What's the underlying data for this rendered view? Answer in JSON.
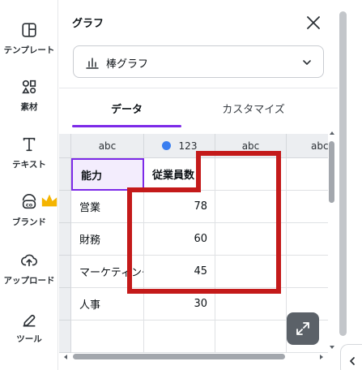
{
  "sidebar": {
    "items": [
      {
        "label": "テンプレート",
        "icon": "template-icon"
      },
      {
        "label": "素材",
        "icon": "elements-icon"
      },
      {
        "label": "テキスト",
        "icon": "text-icon"
      },
      {
        "label": "ブランド",
        "icon": "brand-icon",
        "premium": true
      },
      {
        "label": "アップロード",
        "icon": "upload-icon"
      },
      {
        "label": "ツール",
        "icon": "tools-icon"
      }
    ]
  },
  "panel": {
    "title": "グラフ",
    "chart_type": "棒グラフ",
    "tabs": [
      {
        "label": "データ",
        "active": true
      },
      {
        "label": "カスタマイズ",
        "active": false
      }
    ]
  },
  "grid": {
    "column_types": [
      "abc",
      "123",
      "abc",
      "abc"
    ],
    "header_row": [
      "能力",
      "従業員数"
    ],
    "rows": [
      [
        "営業",
        "78"
      ],
      [
        "財務",
        "60"
      ],
      [
        "マーケティング",
        "45"
      ],
      [
        "人事",
        "30"
      ]
    ]
  },
  "colors": {
    "accent": "#7d2ae8",
    "series_dot": "#3a7ef0",
    "highlight_box": "#c41a1a",
    "crown": "#f4b400"
  }
}
